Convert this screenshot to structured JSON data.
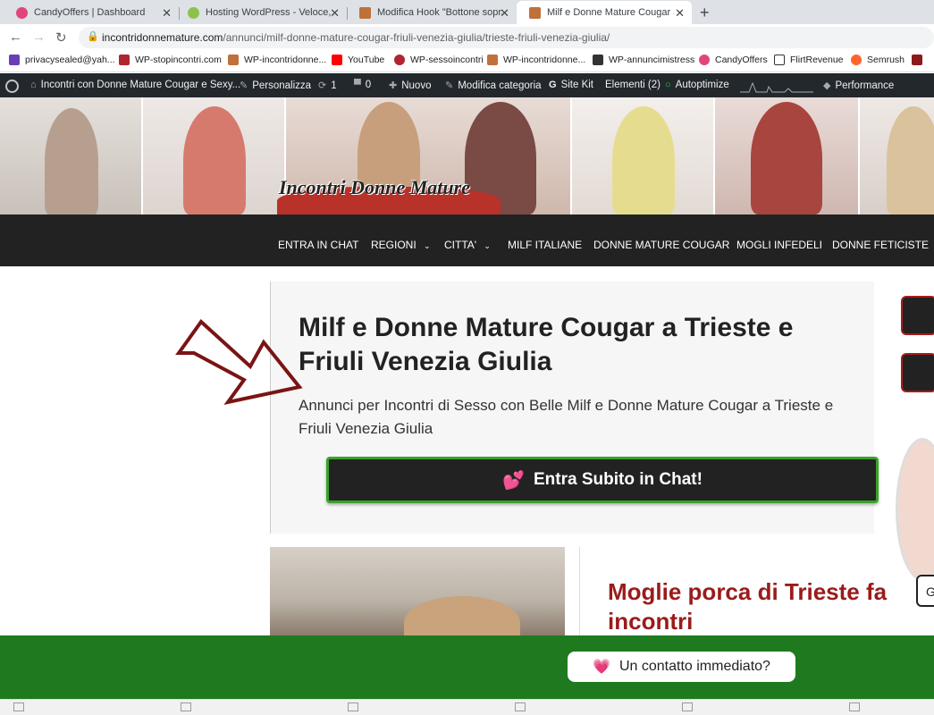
{
  "browser": {
    "tabs": [
      {
        "title": "CandyOffers | Dashboard",
        "active": false
      },
      {
        "title": "Hosting WordPress - Veloce, sicuro",
        "active": false
      },
      {
        "title": "Modifica Hook \"Bottone sopra Con",
        "active": false
      },
      {
        "title": "Milf e Donne Mature Cougar a Tries",
        "active": true
      }
    ],
    "url_domain": "incontridonnemature.com",
    "url_path": "/annunci/milf-donne-mature-cougar-friuli-venezia-giulia/trieste-friuli-venezia-giulia/",
    "bookmarks": [
      "privacysealed@yah...",
      "WP-stopincontri.com",
      "WP-incontridonne...",
      "YouTube",
      "WP-sessoincontri",
      "WP-incontridonne...",
      "WP-annuncimistress",
      "CandyOffers",
      "FlirtRevenue",
      "Semrush"
    ]
  },
  "wpbar": {
    "site": "Incontri con Donne Mature Cougar e Sexy...",
    "customize": "Personalizza",
    "updates": "1",
    "comments": "0",
    "new": "Nuovo",
    "edit_category": "Modifica categoria",
    "sitekit": "Site Kit",
    "elements": "Elementi (2)",
    "autoptimize": "Autoptimize",
    "performance": "Performance"
  },
  "site": {
    "logo": "Incontri Donne Mature",
    "menu": [
      "ENTRA IN CHAT",
      "REGIONI",
      "CITTA'",
      "MILF ITALIANE",
      "DONNE MATURE COUGAR",
      "MOGLI INFEDELI",
      "DONNE FETICISTE"
    ]
  },
  "main": {
    "title": "Milf e Donne Mature Cougar a Trieste e Friuli Venezia Giulia",
    "subtitle": "Annunci per Incontri di Sesso con Belle Milf e Donne Mature Cougar a Trieste e Friuli Venezia Giulia",
    "cta": "Entra Subito in Chat!",
    "side_label": "G",
    "post_title": "Moglie porca di Trieste fa incontri"
  },
  "footer_bar": {
    "contact": "Un contatto immediato?"
  },
  "colors": {
    "cta_border": "#3aa12a",
    "green_bar": "#1f7a1f",
    "post_title": "#9a1b1b",
    "admin_bar": "#23282d"
  }
}
